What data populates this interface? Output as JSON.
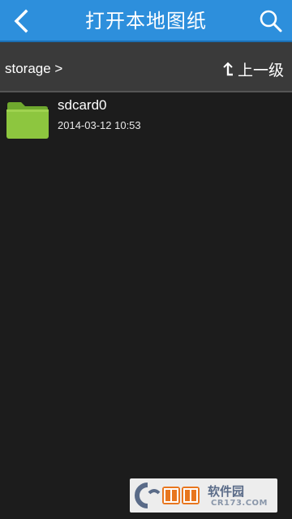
{
  "header": {
    "title": "打开本地图纸",
    "back_icon": "chevron-left-icon",
    "search_icon": "search-icon",
    "background_color": "#2d8fdc"
  },
  "pathbar": {
    "path": "storage >",
    "up_label": "上一级",
    "up_icon": "return-up-icon"
  },
  "files": [
    {
      "name": "sdcard0",
      "date": "2014-03-12 10:53",
      "icon": "folder-icon",
      "icon_color": "#8dc63f"
    }
  ],
  "watermark": {
    "brand": "软件园",
    "site": "CR173.COM"
  }
}
